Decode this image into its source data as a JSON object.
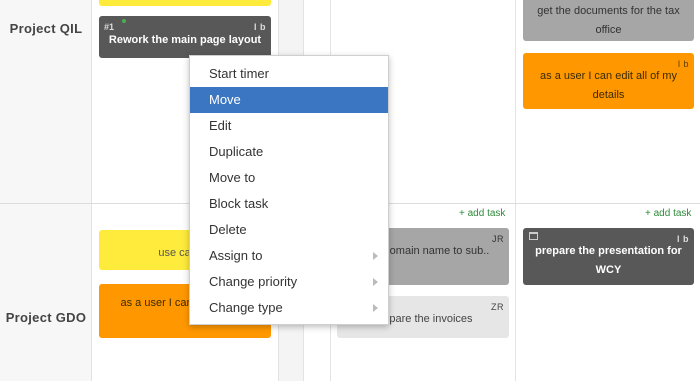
{
  "rows": [
    {
      "label": "Project QIL"
    },
    {
      "label": "Project GDO"
    }
  ],
  "add_task_label": "+ add task",
  "cards": {
    "top_yellow": {
      "text": ""
    },
    "rework": {
      "id": "#1",
      "initials": "l b",
      "text": "Rework the main page layout"
    },
    "tax_docs": {
      "text": "get the documents for the tax office"
    },
    "edit_details": {
      "initials": "l b",
      "text": "as a user I can edit all of my details"
    },
    "use_case": {
      "text": "use case 8"
    },
    "user_can": {
      "text": "as a user I can details in P"
    },
    "subdomain": {
      "initials": "JR",
      "text": "e subdomain name to sub.."
    },
    "invoices": {
      "initials": "ZR",
      "text": "prepare the invoices"
    },
    "presentation": {
      "initials": "l b",
      "text": "prepare the presentation for WCY"
    }
  },
  "context_menu": {
    "items": [
      {
        "label": "Start timer",
        "submenu": false
      },
      {
        "label": "Move",
        "submenu": false,
        "active": true
      },
      {
        "label": "Edit",
        "submenu": false
      },
      {
        "label": "Duplicate",
        "submenu": false
      },
      {
        "label": "Move to",
        "submenu": false
      },
      {
        "label": "Block task",
        "submenu": false
      },
      {
        "label": "Delete",
        "submenu": false
      },
      {
        "label": "Assign to",
        "submenu": true
      },
      {
        "label": "Change priority",
        "submenu": true
      },
      {
        "label": "Change type",
        "submenu": true
      }
    ]
  },
  "colors": {
    "yellow": "#ffeb3b",
    "orange": "#ff9800",
    "dark": "#585858",
    "gray": "#a6a6a6",
    "menu_highlight": "#3b76c3",
    "add_task": "#2e8b3a"
  }
}
